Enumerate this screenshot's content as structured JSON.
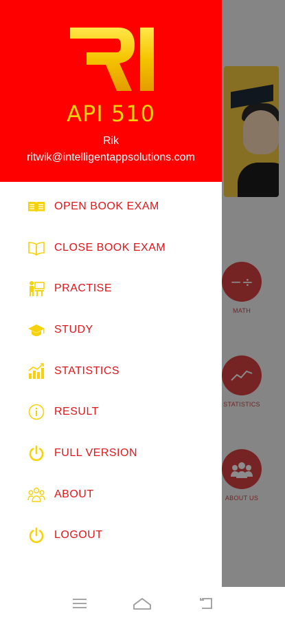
{
  "app": {
    "title": "API 510",
    "logo_text": "RI"
  },
  "user": {
    "name": "Rik",
    "email": "ritwik@intelligentappsolutions.com"
  },
  "colors": {
    "header_red": "#fe0000",
    "accent_yellow": "#f6d20a",
    "menu_text_red": "#e0161b"
  },
  "menu": [
    {
      "label": "OPEN BOOK EXAM",
      "icon": "open-book-icon"
    },
    {
      "label": "CLOSE BOOK EXAM",
      "icon": "closed-book-icon"
    },
    {
      "label": "PRACTISE",
      "icon": "practise-icon"
    },
    {
      "label": "STUDY",
      "icon": "graduation-cap-icon"
    },
    {
      "label": "STATISTICS",
      "icon": "bar-chart-icon"
    },
    {
      "label": "RESULT",
      "icon": "info-icon"
    },
    {
      "label": "FULL VERSION",
      "icon": "power-icon"
    },
    {
      "label": "ABOUT",
      "icon": "people-icon"
    },
    {
      "label": "LOGOUT",
      "icon": "power-icon"
    }
  ],
  "background": {
    "tiles": [
      {
        "label": "MATH",
        "icon": "math-icon"
      },
      {
        "label": "STATISTICS",
        "icon": "chart-icon"
      },
      {
        "label": "ABOUT US",
        "icon": "group-icon"
      }
    ]
  },
  "navbar": {
    "buttons": [
      "menu-icon",
      "home-icon",
      "back-icon"
    ]
  }
}
